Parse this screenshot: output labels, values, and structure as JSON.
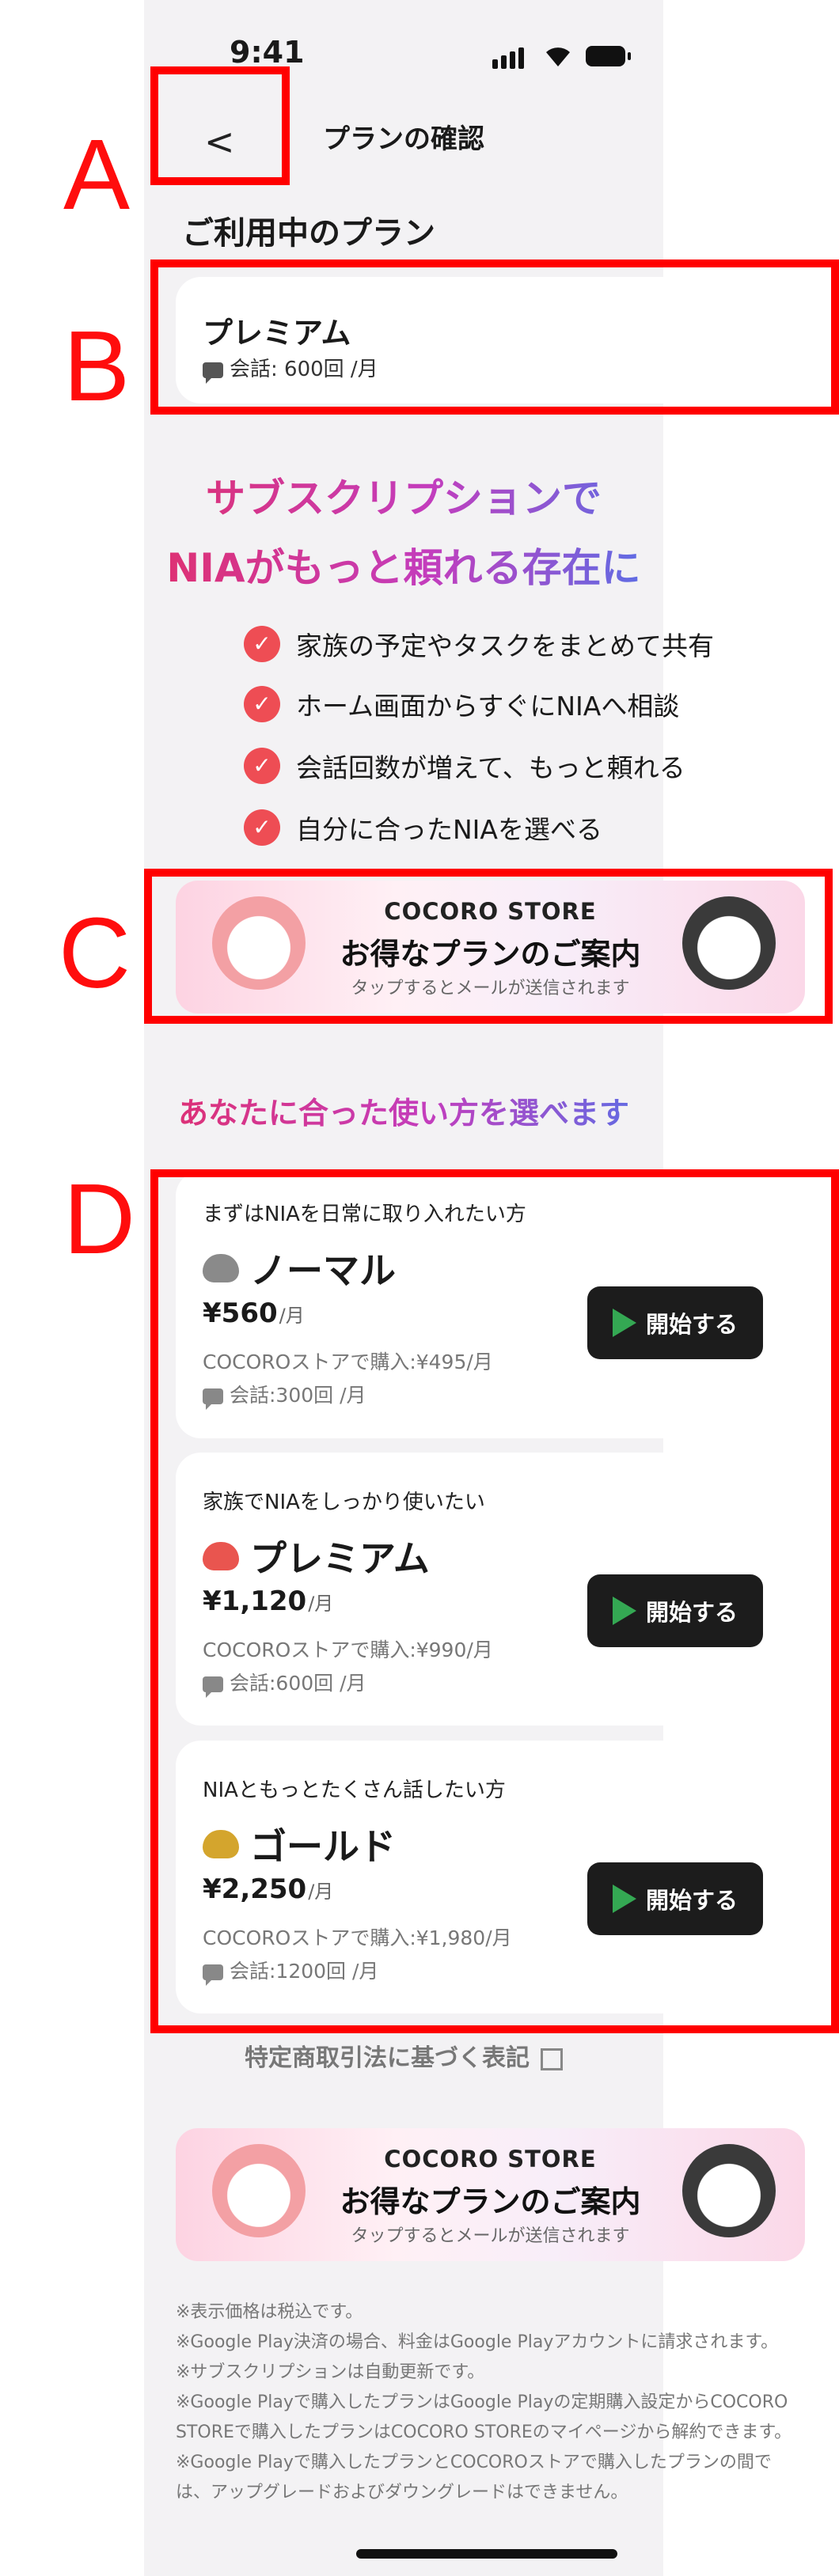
{
  "status_bar": {
    "time": "9:41"
  },
  "header": {
    "title": "プランの確認",
    "back_glyph": "<"
  },
  "current_plan": {
    "section_title": "ご利用中のプラン",
    "name": "プレミアム",
    "conversations": "会話: 600回 /月"
  },
  "promo": {
    "headline_line1": "サブスクリプションで",
    "headline_line2": "NIAがもっと頼れる存在に",
    "features": [
      "家族の予定やタスクをまとめて共有",
      "ホーム画面からすぐにNIAへ相談",
      "会話回数が増えて、もっと頼れる",
      "自分に合ったNIAを選べる"
    ]
  },
  "store_banner": {
    "store": "COCORO STORE",
    "main": "お得なプランのご案内",
    "sub": "タップするとメールが送信されます"
  },
  "plans_section_title": "あなたに合った使い方を選べます",
  "plans": [
    {
      "tag": "まずはNIAを日常に取り入れたい方",
      "name": "ノーマル",
      "price": "¥560",
      "unit": "/月",
      "store_price": "COCOROストアで購入:¥495/月",
      "conversations": "会話:300回 /月",
      "button": "開始する",
      "icon_color": "#8a8a8a"
    },
    {
      "tag": "家族でNIAをしっかり使いたい",
      "name": "プレミアム",
      "price": "¥1,120",
      "unit": "/月",
      "store_price": "COCOROストアで購入:¥990/月",
      "conversations": "会話:600回 /月",
      "button": "開始する",
      "icon_color": "#e9554f"
    },
    {
      "tag": "NIAともっとたくさん話したい方",
      "name": "ゴールド",
      "price": "¥2,250",
      "unit": "/月",
      "store_price": "COCOROストアで購入:¥1,980/月",
      "conversations": "会話:1200回 /月",
      "button": "開始する",
      "icon_color": "#d4a52d"
    }
  ],
  "legal_link": "特定商取引法に基づく表記",
  "notes": [
    "※表示価格は税込です。",
    "※Google Play決済の場合、料金はGoogle Playアカウントに請求されます。",
    "※サブスクリプションは自動更新です。",
    "※Google Playで購入したプランはGoogle Playの定期購入設定からCOCORO",
    "STOREで購入したプランはCOCORO STOREのマイページから解約できます。",
    "※Google Playで購入したプランとCOCOROストアで購入したプランの間で",
    "は、アップグレードおよびダウングレードはできません。"
  ],
  "annotations": {
    "a": "A",
    "b": "B",
    "c": "C",
    "d": "D"
  },
  "colors": {
    "accent_red": "#ff0000",
    "check_red": "#ee4d54",
    "button_dark": "#1c1c1c"
  }
}
